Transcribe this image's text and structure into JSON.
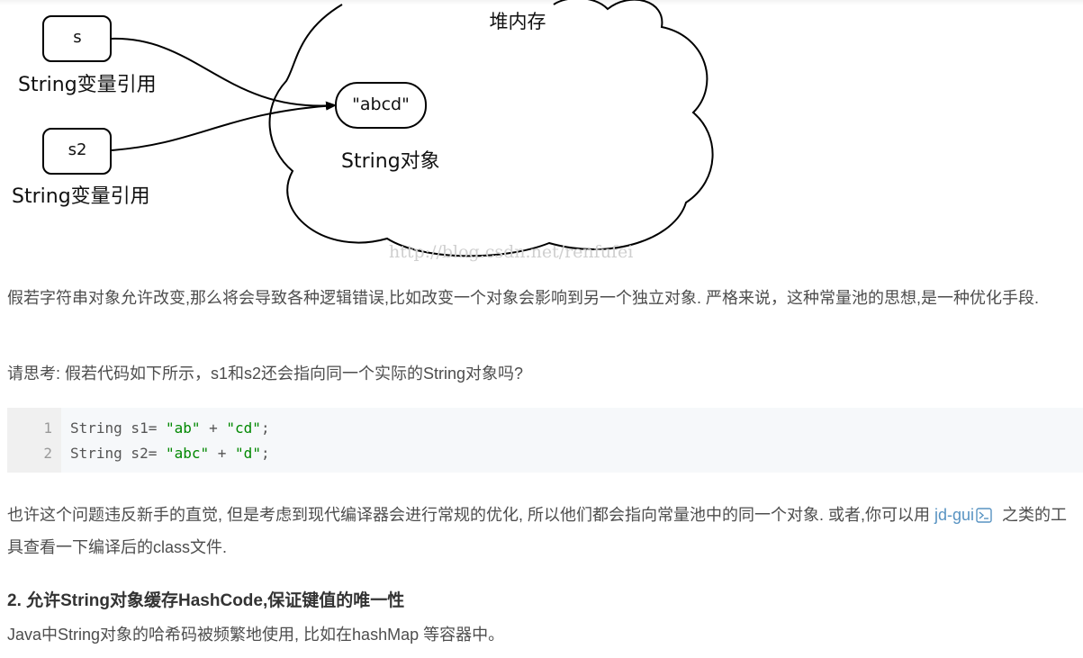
{
  "diagram": {
    "heap_label": "堆内存",
    "var1_box": "s",
    "var1_label": "String变量引用",
    "var2_box": "s2",
    "var2_label": "String变量引用",
    "object_box": "\"abcd\"",
    "object_label": "String对象",
    "watermark": "http://blog.csdn.net/renfufei"
  },
  "paragraph1": "假若字符串对象允许改变,那么将会导致各种逻辑错误,比如改变一个对象会影响到另一个独立对象. 严格来说，这种常量池的思想,是一种优化手段.",
  "paragraph2": "请思考: 假若代码如下所示，s1和s2还会指向同一个实际的String对象吗?",
  "code": {
    "line_numbers": [
      "1",
      "2"
    ],
    "lines": [
      {
        "pre": "String s1= ",
        "str1": "\"ab\"",
        "mid": " + ",
        "str2": "\"cd\"",
        "post": ";"
      },
      {
        "pre": "String s2= ",
        "str1": "\"abc\"",
        "mid": " + ",
        "str2": "\"d\"",
        "post": ";"
      }
    ]
  },
  "paragraph3": {
    "before": "也许这个问题违反新手的直觉, 但是考虑到现代编译器会进行常规的优化, 所以他们都会指向常量池中的同一个对象. 或者,你可以用 ",
    "link_text": "jd-gui",
    "after": " 之类的工具查看一下编译后的class文件."
  },
  "heading": "2. 允许String对象缓存HashCode,保证键值的唯一性",
  "paragraph4": "Java中String对象的哈希码被频繁地使用, 比如在hashMap 等容器中。",
  "colors": {
    "link": "#5893c2",
    "string_literal": "#008800",
    "code_bg": "#f6f8fa"
  }
}
